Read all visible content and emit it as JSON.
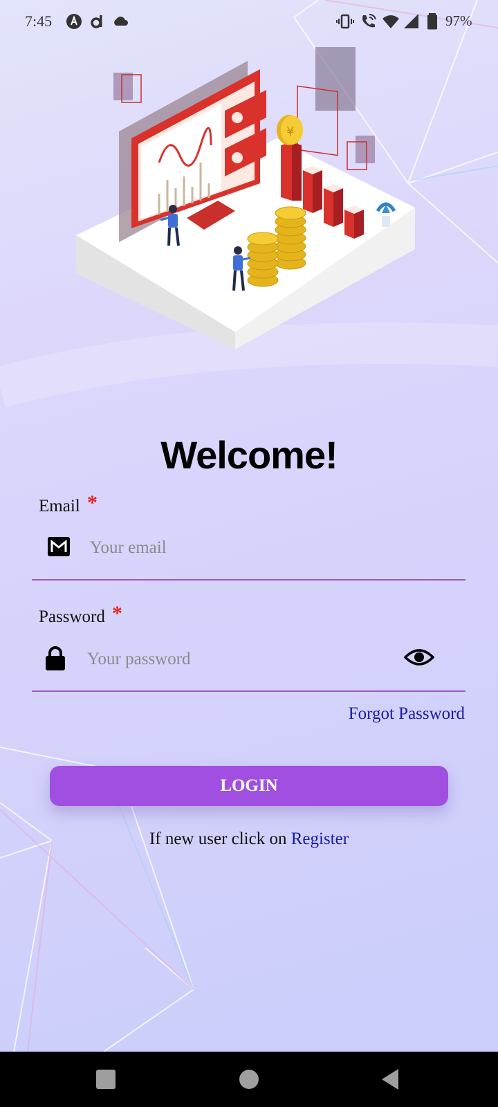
{
  "status_bar": {
    "time": "7:45",
    "battery": "97%",
    "left_icons": [
      "assistant-icon",
      "d-app-icon",
      "cloud-icon"
    ],
    "right_icons": [
      "vibrate-icon",
      "wifi-calling-icon",
      "wifi-icon",
      "signal-icon",
      "battery-icon"
    ]
  },
  "hero": {
    "illustration": "finance-dashboard-illustration"
  },
  "welcome": {
    "title": "Welcome!"
  },
  "email": {
    "label": "Email",
    "required_mark": "*",
    "placeholder": "Your email",
    "value": "",
    "icon": "gmail-icon"
  },
  "password": {
    "label": "Password",
    "required_mark": "*",
    "placeholder": "Your password",
    "value": "",
    "icon": "lock-icon",
    "toggle_icon": "eye-icon"
  },
  "forgot_password": "Forgot Password",
  "login": {
    "label": "LOGIN"
  },
  "register": {
    "prefix": "If new user click on ",
    "link": "Register"
  },
  "nav_bar": {
    "buttons": [
      "recents-button",
      "home-button",
      "back-button"
    ]
  },
  "colors": {
    "accent": "#a04fe0",
    "link": "#1b19a8",
    "required": "#e8231f",
    "underline": "#9a57c6"
  }
}
